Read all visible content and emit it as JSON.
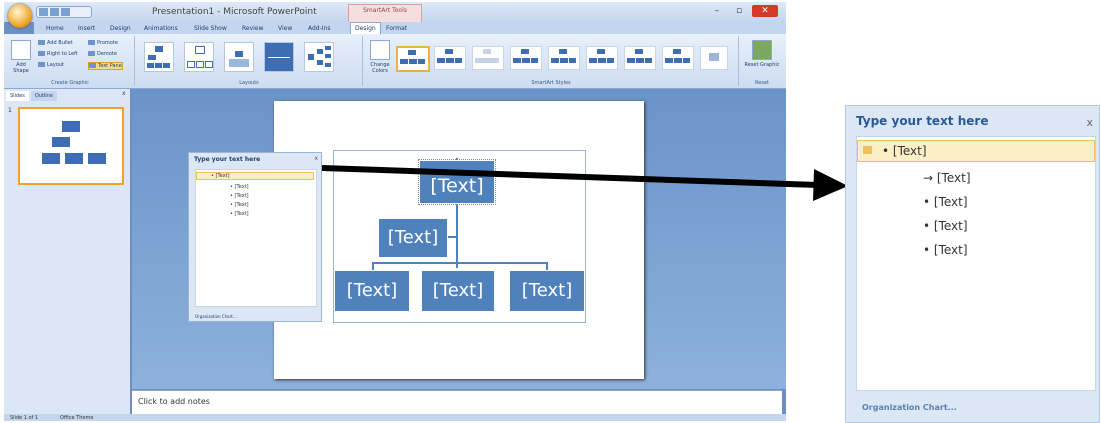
{
  "window": {
    "title": "Presentation1 - Microsoft PowerPoint",
    "contextual_tab": "SmartArt Tools",
    "minimize": "–",
    "maximize": "▫",
    "close": "✕"
  },
  "tabs": [
    "Home",
    "Insert",
    "Design",
    "Animations",
    "Slide Show",
    "Review",
    "View",
    "Add-Ins",
    "Design",
    "Format"
  ],
  "ribbon": {
    "create_graphic": {
      "add_shape": "Add Shape",
      "add_bullet": "Add Bullet",
      "right_to_left": "Right to Left",
      "layout": "Layout",
      "promote": "Promote",
      "demote": "Demote",
      "text_pane": "Text Pane",
      "group_label": "Create Graphic"
    },
    "layouts": {
      "group_label": "Layouts"
    },
    "styles": {
      "change_colors": "Change Colors",
      "group_label": "SmartArt Styles"
    },
    "reset": {
      "reset_graphic": "Reset Graphic",
      "group_label": "Reset"
    }
  },
  "sidebar": {
    "tabs": [
      "Slides",
      "Outline"
    ],
    "close": "x",
    "slide_number": "1"
  },
  "smartart": {
    "top": "[Text]",
    "mid": "[Text]",
    "bottom": [
      "[Text]",
      "[Text]",
      "[Text]"
    ]
  },
  "text_pane": {
    "title": "Type your text here",
    "close": "x",
    "items": [
      "[Text]",
      "[Text]",
      "[Text]",
      "[Text]",
      "[Text]"
    ],
    "footer": "Organization Chart..."
  },
  "notes": {
    "placeholder": "Click to add notes"
  },
  "statusbar": {
    "slide": "Slide 1 of 1",
    "theme": "Office Theme"
  },
  "colors": {
    "smartart_blue": "#4f81bd",
    "ribbon_bg": "#dce7f6",
    "workspace": "#6b8fc4",
    "close_red": "#d33a2a"
  }
}
